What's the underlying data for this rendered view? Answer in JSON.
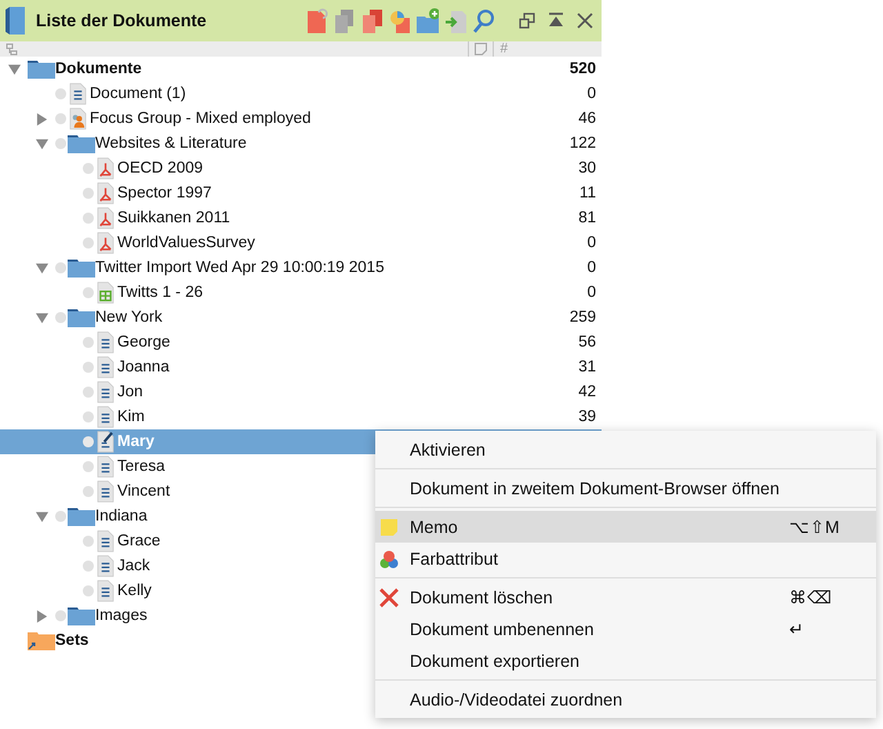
{
  "window": {
    "title": "Liste der Dokumente"
  },
  "header": {
    "count_column": "#"
  },
  "tree": [
    {
      "kind": "folder",
      "label": "Dokumente",
      "count": "520",
      "bold": true,
      "selected": false,
      "expanded": true,
      "children": [
        {
          "kind": "text",
          "label": "Document (1)",
          "count": "0",
          "bold": false,
          "selected": false
        },
        {
          "kind": "focus",
          "label": "Focus Group - Mixed employed",
          "count": "46",
          "bold": false,
          "selected": false,
          "expanded": false
        },
        {
          "kind": "folder",
          "label": "Websites & Literature",
          "count": "122",
          "bold": false,
          "selected": false,
          "expanded": true,
          "children": [
            {
              "kind": "pdf",
              "label": "OECD 2009",
              "count": "30",
              "bold": false,
              "selected": false
            },
            {
              "kind": "pdf",
              "label": "Spector 1997",
              "count": "11",
              "bold": false,
              "selected": false
            },
            {
              "kind": "pdf",
              "label": "Suikkanen 2011",
              "count": "81",
              "bold": false,
              "selected": false
            },
            {
              "kind": "pdf",
              "label": "WorldValuesSurvey",
              "count": "0",
              "bold": false,
              "selected": false
            }
          ]
        },
        {
          "kind": "folder",
          "label": "Twitter Import Wed Apr 29 10:00:19 2015",
          "count": "0",
          "bold": false,
          "selected": false,
          "expanded": true,
          "children": [
            {
              "kind": "table",
              "label": "Twitts 1 - 26",
              "count": "0",
              "bold": false,
              "selected": false
            }
          ]
        },
        {
          "kind": "folder",
          "label": "New York",
          "count": "259",
          "bold": false,
          "selected": false,
          "expanded": true,
          "children": [
            {
              "kind": "text",
              "label": "George",
              "count": "56",
              "bold": false,
              "selected": false
            },
            {
              "kind": "text",
              "label": "Joanna",
              "count": "31",
              "bold": false,
              "selected": false
            },
            {
              "kind": "text",
              "label": "Jon",
              "count": "42",
              "bold": false,
              "selected": false
            },
            {
              "kind": "text",
              "label": "Kim",
              "count": "39",
              "bold": false,
              "selected": false
            },
            {
              "kind": "memo",
              "label": "Mary",
              "bold": true,
              "selected": true
            },
            {
              "kind": "text",
              "label": "Teresa",
              "bold": false,
              "selected": false
            },
            {
              "kind": "text",
              "label": "Vincent",
              "bold": false,
              "selected": false
            }
          ]
        },
        {
          "kind": "folder",
          "label": "Indiana",
          "bold": false,
          "selected": false,
          "expanded": true,
          "children": [
            {
              "kind": "text",
              "label": "Grace",
              "bold": false,
              "selected": false
            },
            {
              "kind": "text",
              "label": "Jack",
              "bold": false,
              "selected": false
            },
            {
              "kind": "text",
              "label": "Kelly",
              "bold": false,
              "selected": false
            }
          ]
        },
        {
          "kind": "folder",
          "label": "Images",
          "bold": false,
          "selected": false,
          "expanded": false
        }
      ]
    },
    {
      "kind": "set",
      "label": "Sets",
      "bold": true,
      "selected": false
    }
  ],
  "context_menu": [
    {
      "kind": "item",
      "label": "Aktivieren",
      "selected": false
    },
    {
      "kind": "separator"
    },
    {
      "kind": "item",
      "label": "Dokument in zweitem Dokument-Browser öffnen",
      "selected": false
    },
    {
      "kind": "separator"
    },
    {
      "kind": "memo",
      "label": "Memo",
      "shortcut": "⌥⇧M",
      "selected": true
    },
    {
      "kind": "color",
      "label": "Farbattribut",
      "selected": false
    },
    {
      "kind": "separator"
    },
    {
      "kind": "delete",
      "label": "Dokument löschen",
      "shortcut": "⌘⌫",
      "selected": false
    },
    {
      "kind": "item",
      "label": "Dokument umbenennen",
      "shortcut": "↵",
      "selected": false
    },
    {
      "kind": "item",
      "label": "Dokument exportieren",
      "selected": false
    },
    {
      "kind": "separator"
    },
    {
      "kind": "item",
      "label": "Audio-/Videodatei zuordnen",
      "selected": false
    }
  ]
}
